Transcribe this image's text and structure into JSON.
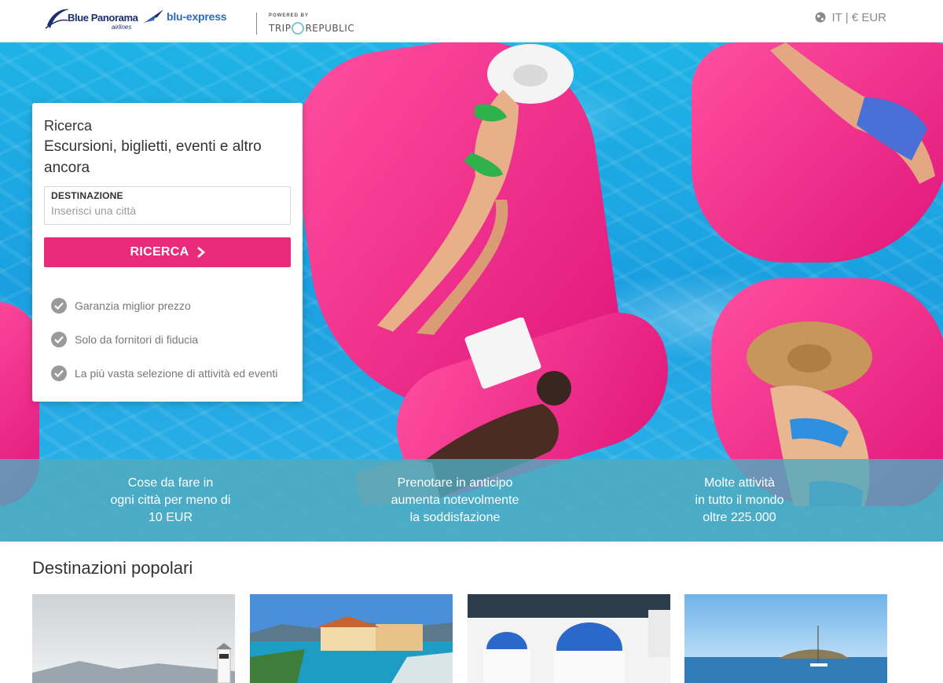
{
  "header": {
    "logo_primary": "Blue Panorama",
    "logo_primary_sub": "airlines",
    "logo_secondary": "blu-express",
    "powered_by": "POWERED BY",
    "partner_left": "TRIP",
    "partner_right": "REPUBLIC",
    "language": "IT",
    "separator": "|",
    "currency": "€ EUR",
    "icons": {
      "language": "globe-icon"
    }
  },
  "search": {
    "title": "Ricerca",
    "subtitle": "Escursioni, biglietti, eventi e altro ancora",
    "destination_label": "DESTINAZIONE",
    "destination_value": "",
    "destination_placeholder": "Inserisci una città",
    "button_label": "RICERCA",
    "features": [
      "Garanzia miglior prezzo",
      "Solo da fornitori di fiducia",
      "La più vasta selezione di attività ed eventi"
    ]
  },
  "band": [
    {
      "line1": "Cose da fare in",
      "line2": "ogni città per meno di",
      "line3": "10 EUR"
    },
    {
      "line1": "Prenotare in anticipo",
      "line2": "aumenta notevolmente",
      "line3": "la soddisfazione"
    },
    {
      "line1": "Molte attività",
      "line2": "in tutto il mondo",
      "line3": "oltre 225.000"
    }
  ],
  "popular": {
    "title": "Destinazioni popolari"
  },
  "colors": {
    "accent": "#ea2a7a",
    "band": "#50aabe",
    "brand_blue": "#1c2f6e",
    "water": "#1fb3e6"
  }
}
